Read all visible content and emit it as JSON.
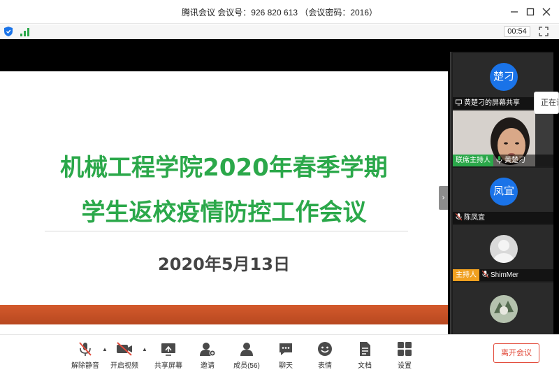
{
  "window": {
    "title": "腾讯会议  会议号：926 820 613 （会议密码：2016）",
    "minimize_icon": "minimize-icon",
    "maximize_icon": "maximize-icon",
    "close_icon": "close-icon"
  },
  "status": {
    "timer": "00:54"
  },
  "slide": {
    "line1": "机械工程学院2020年春季学期",
    "line2": "学生返校疫情防控工作会议",
    "date": "2020年5月13日",
    "title_color": "#2ba84a",
    "band_color": "#c8522a"
  },
  "participants": [
    {
      "avatar_text": "楚刁",
      "label": "黄楚刁的屏幕共享",
      "kind": "share"
    },
    {
      "badge": "联席主持人",
      "name": "黄楚刁",
      "kind": "video"
    },
    {
      "avatar_text": "凤宜",
      "name": "陈凤宜",
      "kind": "avatar"
    },
    {
      "badge": "主持人",
      "name": "ShimMer",
      "kind": "gray-avatar"
    }
  ],
  "overflow_chip": "正在讲",
  "toolbar": {
    "items": [
      {
        "label": "解除静音",
        "icon": "mic-muted-icon"
      },
      {
        "label": "开启视频",
        "icon": "video-off-icon"
      },
      {
        "label": "共享屏幕",
        "icon": "share-screen-icon"
      },
      {
        "label": "邀请",
        "icon": "invite-icon"
      },
      {
        "label": "成员(56)",
        "icon": "members-icon"
      },
      {
        "label": "聊天",
        "icon": "chat-icon"
      },
      {
        "label": "表情",
        "icon": "emoji-icon"
      },
      {
        "label": "文档",
        "icon": "document-icon"
      },
      {
        "label": "设置",
        "icon": "settings-icon"
      }
    ],
    "leave_label": "离开会议"
  },
  "colors": {
    "accent_blue": "#1a73e8",
    "leave_red": "#e24b3b",
    "signal_green": "#2ba84a"
  }
}
